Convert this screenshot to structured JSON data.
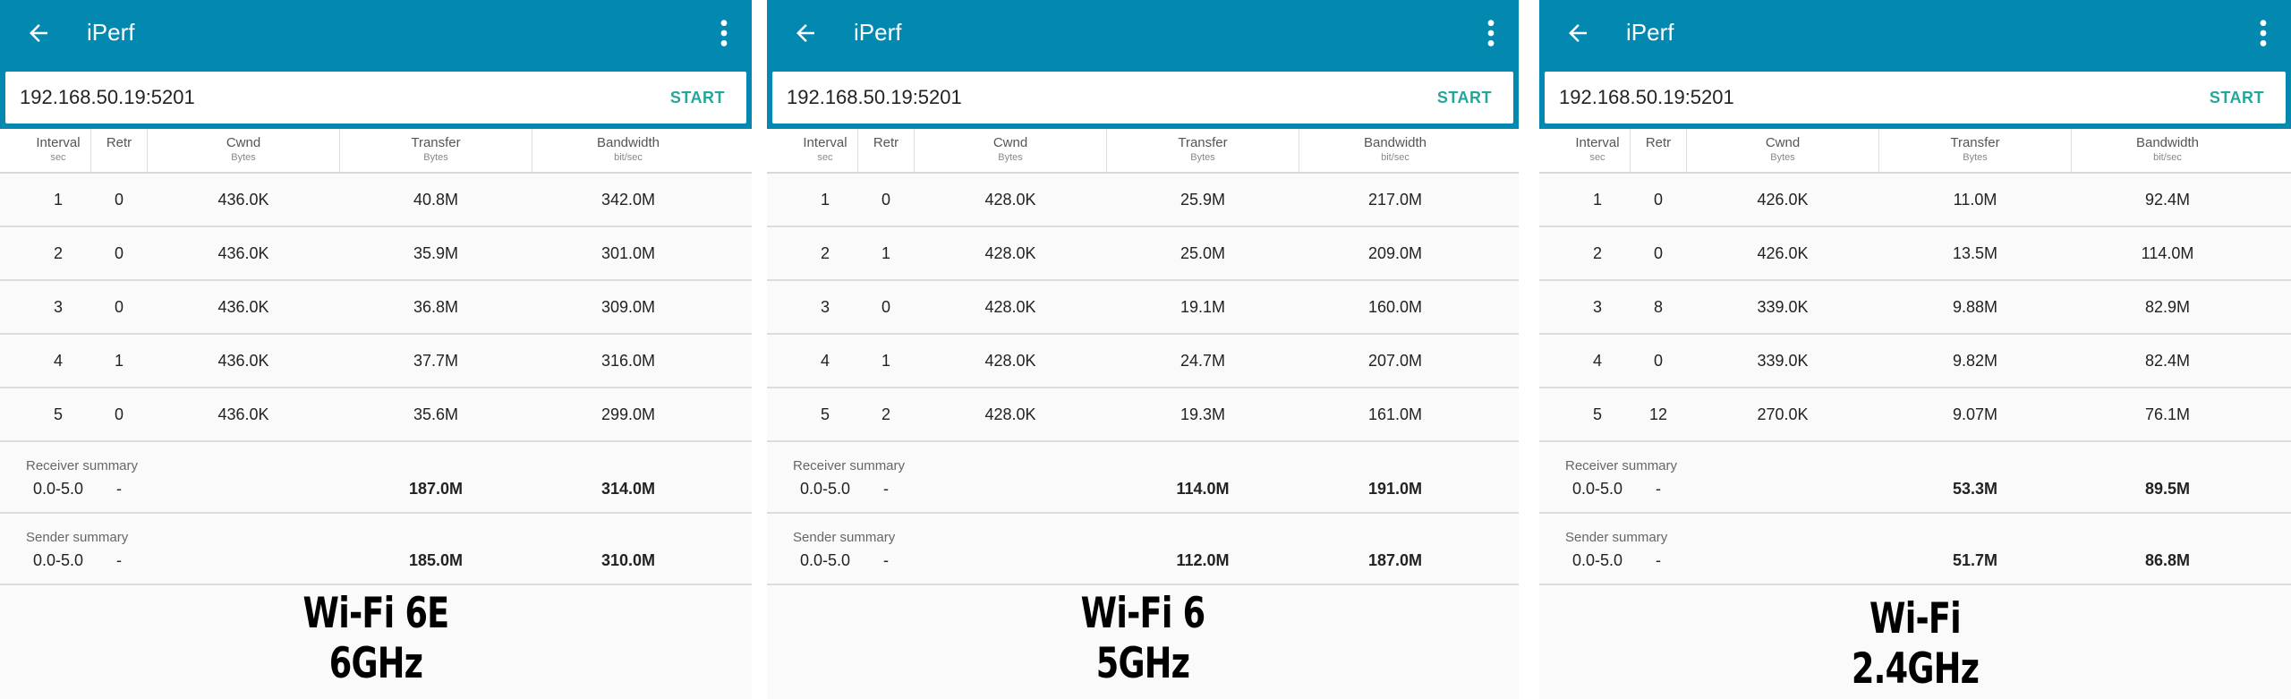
{
  "app": {
    "title": "iPerf"
  },
  "colors": {
    "appbar": "#0388b0",
    "accent": "#26a69a",
    "background": "#fafafa"
  },
  "icons": {
    "back": "back-arrow-icon",
    "menu": "more-vert-icon"
  },
  "columns": [
    {
      "title": "Interval",
      "unit": "sec"
    },
    {
      "title": "Retr",
      "unit": ""
    },
    {
      "title": "Cwnd",
      "unit": "Bytes"
    },
    {
      "title": "Transfer",
      "unit": "Bytes"
    },
    {
      "title": "Bandwidth",
      "unit": "bit/sec"
    }
  ],
  "panels": [
    {
      "host": "192.168.50.19:5201",
      "start_label": "START",
      "rows": [
        {
          "interval": "1",
          "retr": "0",
          "cwnd": "436.0K",
          "transfer": "40.8M",
          "bandwidth": "342.0M"
        },
        {
          "interval": "2",
          "retr": "0",
          "cwnd": "436.0K",
          "transfer": "35.9M",
          "bandwidth": "301.0M"
        },
        {
          "interval": "3",
          "retr": "0",
          "cwnd": "436.0K",
          "transfer": "36.8M",
          "bandwidth": "309.0M"
        },
        {
          "interval": "4",
          "retr": "1",
          "cwnd": "436.0K",
          "transfer": "37.7M",
          "bandwidth": "316.0M"
        },
        {
          "interval": "5",
          "retr": "0",
          "cwnd": "436.0K",
          "transfer": "35.6M",
          "bandwidth": "299.0M"
        }
      ],
      "receiver": {
        "label": "Receiver summary",
        "interval": "0.0-5.0",
        "retr": "-",
        "transfer": "187.0M",
        "bandwidth": "314.0M"
      },
      "sender": {
        "label": "Sender summary",
        "interval": "0.0-5.0",
        "retr": "-",
        "transfer": "185.0M",
        "bandwidth": "310.0M"
      },
      "caption": [
        "Wi-Fi 6E",
        "6GHz"
      ]
    },
    {
      "host": "192.168.50.19:5201",
      "start_label": "START",
      "rows": [
        {
          "interval": "1",
          "retr": "0",
          "cwnd": "428.0K",
          "transfer": "25.9M",
          "bandwidth": "217.0M"
        },
        {
          "interval": "2",
          "retr": "1",
          "cwnd": "428.0K",
          "transfer": "25.0M",
          "bandwidth": "209.0M"
        },
        {
          "interval": "3",
          "retr": "0",
          "cwnd": "428.0K",
          "transfer": "19.1M",
          "bandwidth": "160.0M"
        },
        {
          "interval": "4",
          "retr": "1",
          "cwnd": "428.0K",
          "transfer": "24.7M",
          "bandwidth": "207.0M"
        },
        {
          "interval": "5",
          "retr": "2",
          "cwnd": "428.0K",
          "transfer": "19.3M",
          "bandwidth": "161.0M"
        }
      ],
      "receiver": {
        "label": "Receiver summary",
        "interval": "0.0-5.0",
        "retr": "-",
        "transfer": "114.0M",
        "bandwidth": "191.0M"
      },
      "sender": {
        "label": "Sender summary",
        "interval": "0.0-5.0",
        "retr": "-",
        "transfer": "112.0M",
        "bandwidth": "187.0M"
      },
      "caption": [
        "Wi-Fi 6",
        "5GHz"
      ]
    },
    {
      "host": "192.168.50.19:5201",
      "start_label": "START",
      "rows": [
        {
          "interval": "1",
          "retr": "0",
          "cwnd": "426.0K",
          "transfer": "11.0M",
          "bandwidth": "92.4M"
        },
        {
          "interval": "2",
          "retr": "0",
          "cwnd": "426.0K",
          "transfer": "13.5M",
          "bandwidth": "114.0M"
        },
        {
          "interval": "3",
          "retr": "8",
          "cwnd": "339.0K",
          "transfer": "9.88M",
          "bandwidth": "82.9M"
        },
        {
          "interval": "4",
          "retr": "0",
          "cwnd": "339.0K",
          "transfer": "9.82M",
          "bandwidth": "82.4M"
        },
        {
          "interval": "5",
          "retr": "12",
          "cwnd": "270.0K",
          "transfer": "9.07M",
          "bandwidth": "76.1M"
        }
      ],
      "receiver": {
        "label": "Receiver summary",
        "interval": "0.0-5.0",
        "retr": "-",
        "transfer": "53.3M",
        "bandwidth": "89.5M"
      },
      "sender": {
        "label": "Sender summary",
        "interval": "0.0-5.0",
        "retr": "-",
        "transfer": "51.7M",
        "bandwidth": "86.8M"
      },
      "caption": [
        "Wi-Fi",
        "2.4GHz"
      ]
    }
  ]
}
